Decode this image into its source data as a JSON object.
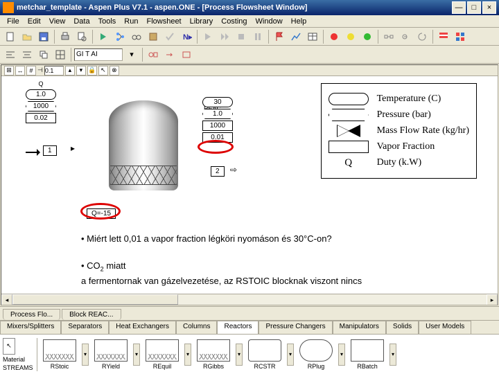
{
  "window": {
    "title": "metchar_template - Aspen Plus V7.1 - aspen.ONE - [Process Flowsheet Window]",
    "close": "×",
    "min": "—",
    "max": "□"
  },
  "menu": [
    "File",
    "Edit",
    "View",
    "Data",
    "Tools",
    "Run",
    "Flowsheet",
    "Library",
    "Costing",
    "Window",
    "Help"
  ],
  "toolbar2": {
    "combo": "GI T AI"
  },
  "ruler": {
    "val1": "0.1"
  },
  "input_stream": {
    "name": "Q",
    "temp": "1.0",
    "pres": "1000",
    "mass": "0.02",
    "id": "1"
  },
  "output_stream": {
    "reac_label": "REAC",
    "temp": "30",
    "pres": "1.0",
    "mass": "1000",
    "vapor": "0.01",
    "out_id": "2"
  },
  "q_value": "Q=-15",
  "legend": {
    "temp": "Temperature (C)",
    "pres": "Pressure (bar)",
    "mass": "Mass Flow Rate (kg/hr)",
    "vapor": "Vapor Fraction",
    "duty": "Duty (k.W)",
    "duty_sym": "Q"
  },
  "questions": {
    "q1": "• Miért lett 0,01 a vapor fraction légköri nyomáson és 30°C-on?",
    "q2a": "• CO",
    "q2a_sub": "2",
    "q2a_tail": " miatt",
    "q2b": "a fermentornak van gázelvezetése, az RSTOIC blocknak viszont nincs"
  },
  "proc_tabs": [
    "Process Flo...",
    "Block REAC..."
  ],
  "modlib_tabs": [
    "Mixers/Splitters",
    "Separators",
    "Heat Exchangers",
    "Columns",
    "Reactors",
    "Pressure Changers",
    "Manipulators",
    "Solids",
    "User Models"
  ],
  "modlib_side": {
    "material": "Material",
    "streams": "STREAMS"
  },
  "models": [
    "RStoic",
    "RYield",
    "REquil",
    "RGibbs",
    "RCSTR",
    "RPlug",
    "RBatch"
  ]
}
